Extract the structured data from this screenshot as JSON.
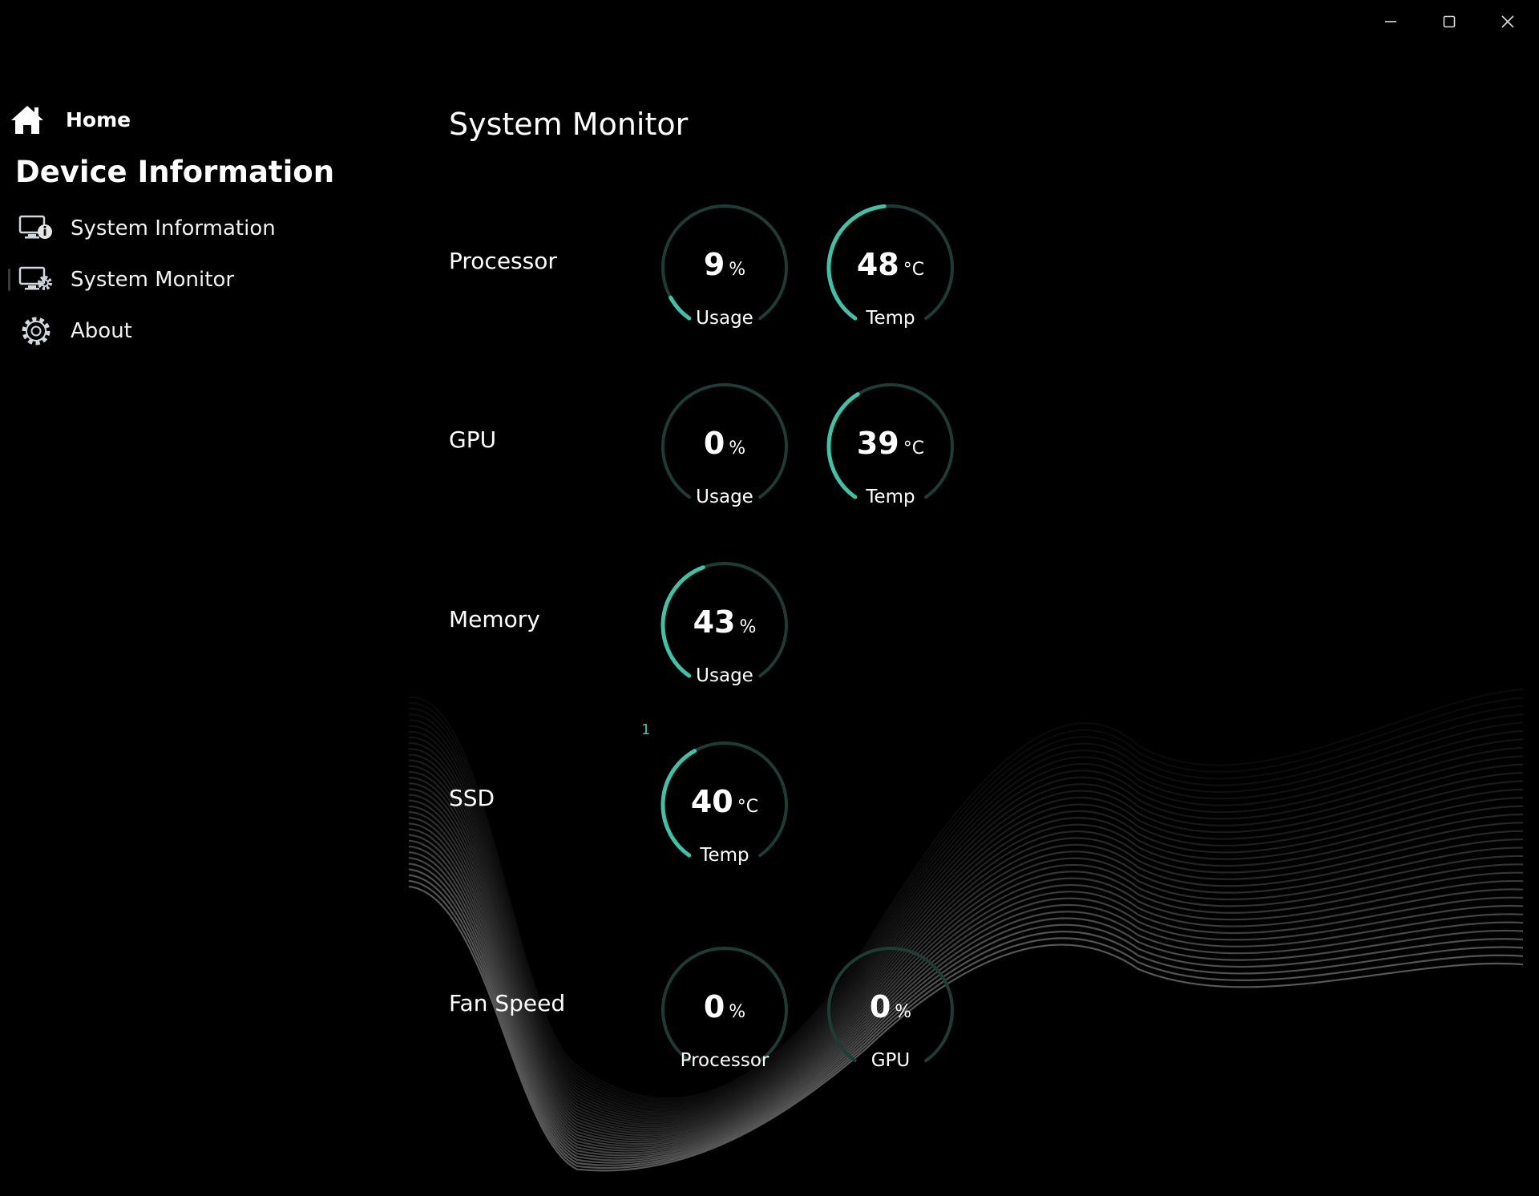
{
  "window": {
    "controls": [
      "minimize-icon",
      "maximize-icon",
      "close-icon"
    ]
  },
  "sidebar": {
    "home_label": "Home",
    "section_title": "Device Information",
    "items": [
      {
        "label": "System Information",
        "icon": "monitor-info-icon",
        "selected": false
      },
      {
        "label": "System Monitor",
        "icon": "monitor-gear-icon",
        "selected": true
      },
      {
        "label": "About",
        "icon": "gear-icon",
        "selected": false
      }
    ]
  },
  "main": {
    "title": "System Monitor",
    "note": "1",
    "rows": [
      {
        "label": "Processor",
        "gauges": [
          {
            "value": "9",
            "unit": "%",
            "caption": "Usage",
            "percent": 9
          },
          {
            "value": "48",
            "unit": "°C",
            "caption": "Temp",
            "percent": 48
          }
        ]
      },
      {
        "label": "GPU",
        "gauges": [
          {
            "value": "0",
            "unit": "%",
            "caption": "Usage",
            "percent": 0
          },
          {
            "value": "39",
            "unit": "°C",
            "caption": "Temp",
            "percent": 39
          }
        ]
      },
      {
        "label": "Memory",
        "gauges": [
          {
            "value": "43",
            "unit": "%",
            "caption": "Usage",
            "percent": 43
          }
        ]
      },
      {
        "label": "SSD",
        "gauges": [
          {
            "value": "40",
            "unit": "°C",
            "caption": "Temp",
            "percent": 40
          }
        ]
      },
      {
        "label": "Fan Speed",
        "gauges": [
          {
            "value": "0",
            "unit": "%",
            "caption": "Processor",
            "percent": 0
          },
          {
            "value": "0",
            "unit": "%",
            "caption": "GPU",
            "percent": 0
          }
        ]
      }
    ]
  },
  "colors": {
    "background": "#000000",
    "accent": "#3ec3a8",
    "track": "#1c3d35",
    "text": "#ffffff"
  }
}
